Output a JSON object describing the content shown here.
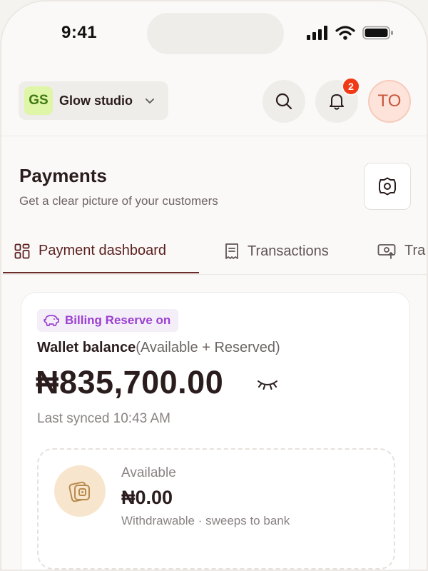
{
  "status_bar": {
    "time": "9:41"
  },
  "header": {
    "workspace": {
      "initials": "GS",
      "name": "Glow studio"
    },
    "notifications_count": "2",
    "profile_initials": "TO"
  },
  "page": {
    "title": "Payments",
    "subtitle": "Get a clear picture of your customers"
  },
  "tabs": [
    {
      "label": "Payment dashboard",
      "icon": "dashboard-grid-icon",
      "active": true
    },
    {
      "label": "Transactions",
      "icon": "receipt-icon",
      "active": false
    },
    {
      "label": "Tra",
      "icon": "money-transfer-icon",
      "active": false
    }
  ],
  "wallet": {
    "reserve_badge": "Billing Reserve on",
    "title": "Wallet balance",
    "title_note": "(Available + Reserved)",
    "amount": "₦835,700.00",
    "last_synced": "Last synced 10:43 AM"
  },
  "available": {
    "label": "Available",
    "amount": "₦0.00",
    "note": "Withdrawable · sweeps to bank"
  },
  "colors": {
    "accent": "#6b2a2a",
    "badge": "#f03a17",
    "reserve": "#9b3fd0",
    "workspace_avatar": "#dff5a8",
    "available_icon_bg": "#f7e6cd"
  }
}
